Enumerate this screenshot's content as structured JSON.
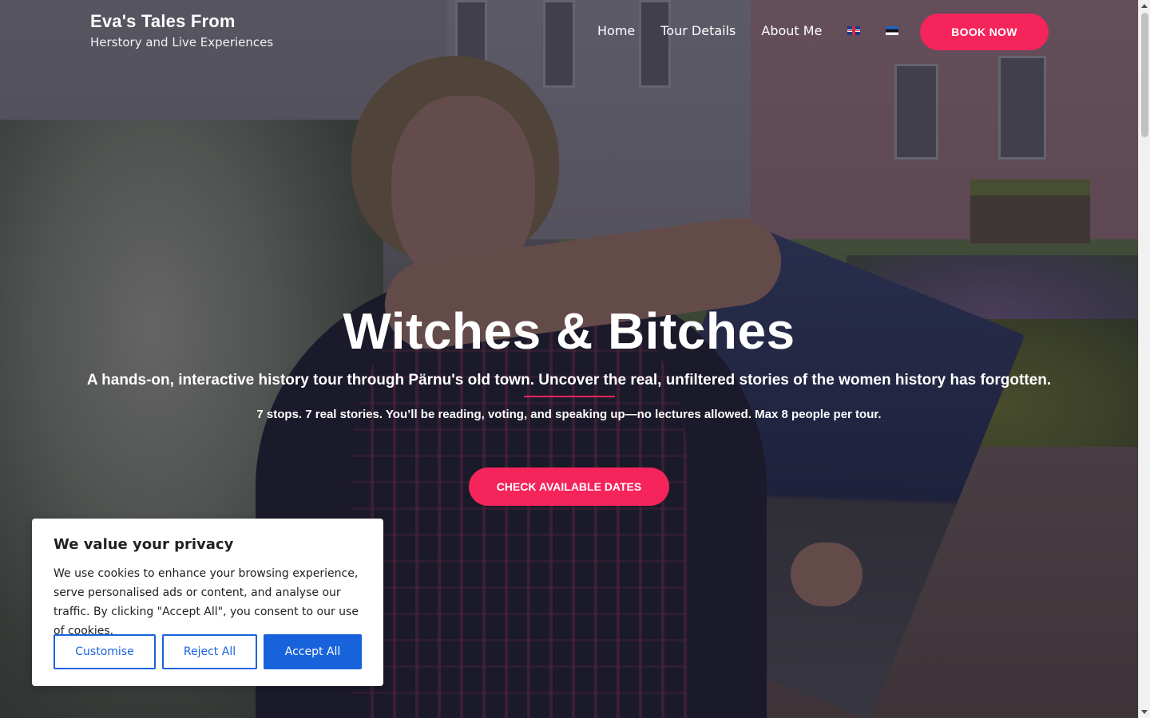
{
  "header": {
    "brand_title": "Eva's Tales From",
    "brand_subtitle": "Herstory and Live Experiences",
    "nav": [
      {
        "label": "Home"
      },
      {
        "label": "Tour Details"
      },
      {
        "label": "About Me"
      }
    ],
    "languages": [
      {
        "icon": "uk-flag-icon",
        "code": "en"
      },
      {
        "icon": "estonia-flag-icon",
        "code": "et"
      }
    ],
    "book_button": "BOOK NOW"
  },
  "hero": {
    "title": "Witches & Bitches",
    "subtitle": "A hands-on, interactive history tour through Pärnu's old town. Uncover the real, unfiltered stories of the women history has forgotten.",
    "detail": "7 stops. 7 real stories. You’ll be reading, voting, and speaking up—no lectures allowed. Max 8 people per tour.",
    "cta": "CHECK AVAILABLE DATES"
  },
  "cookie_banner": {
    "title": "We value your privacy",
    "text": "We use cookies to enhance your browsing experience, serve personalised ads or content, and analyse our traffic. By clicking \"Accept All\", you consent to our use of cookies.",
    "customise": "Customise",
    "reject": "Reject All",
    "accept": "Accept All"
  },
  "colors": {
    "accent": "#f5245b",
    "cookie_primary": "#1863dc"
  }
}
